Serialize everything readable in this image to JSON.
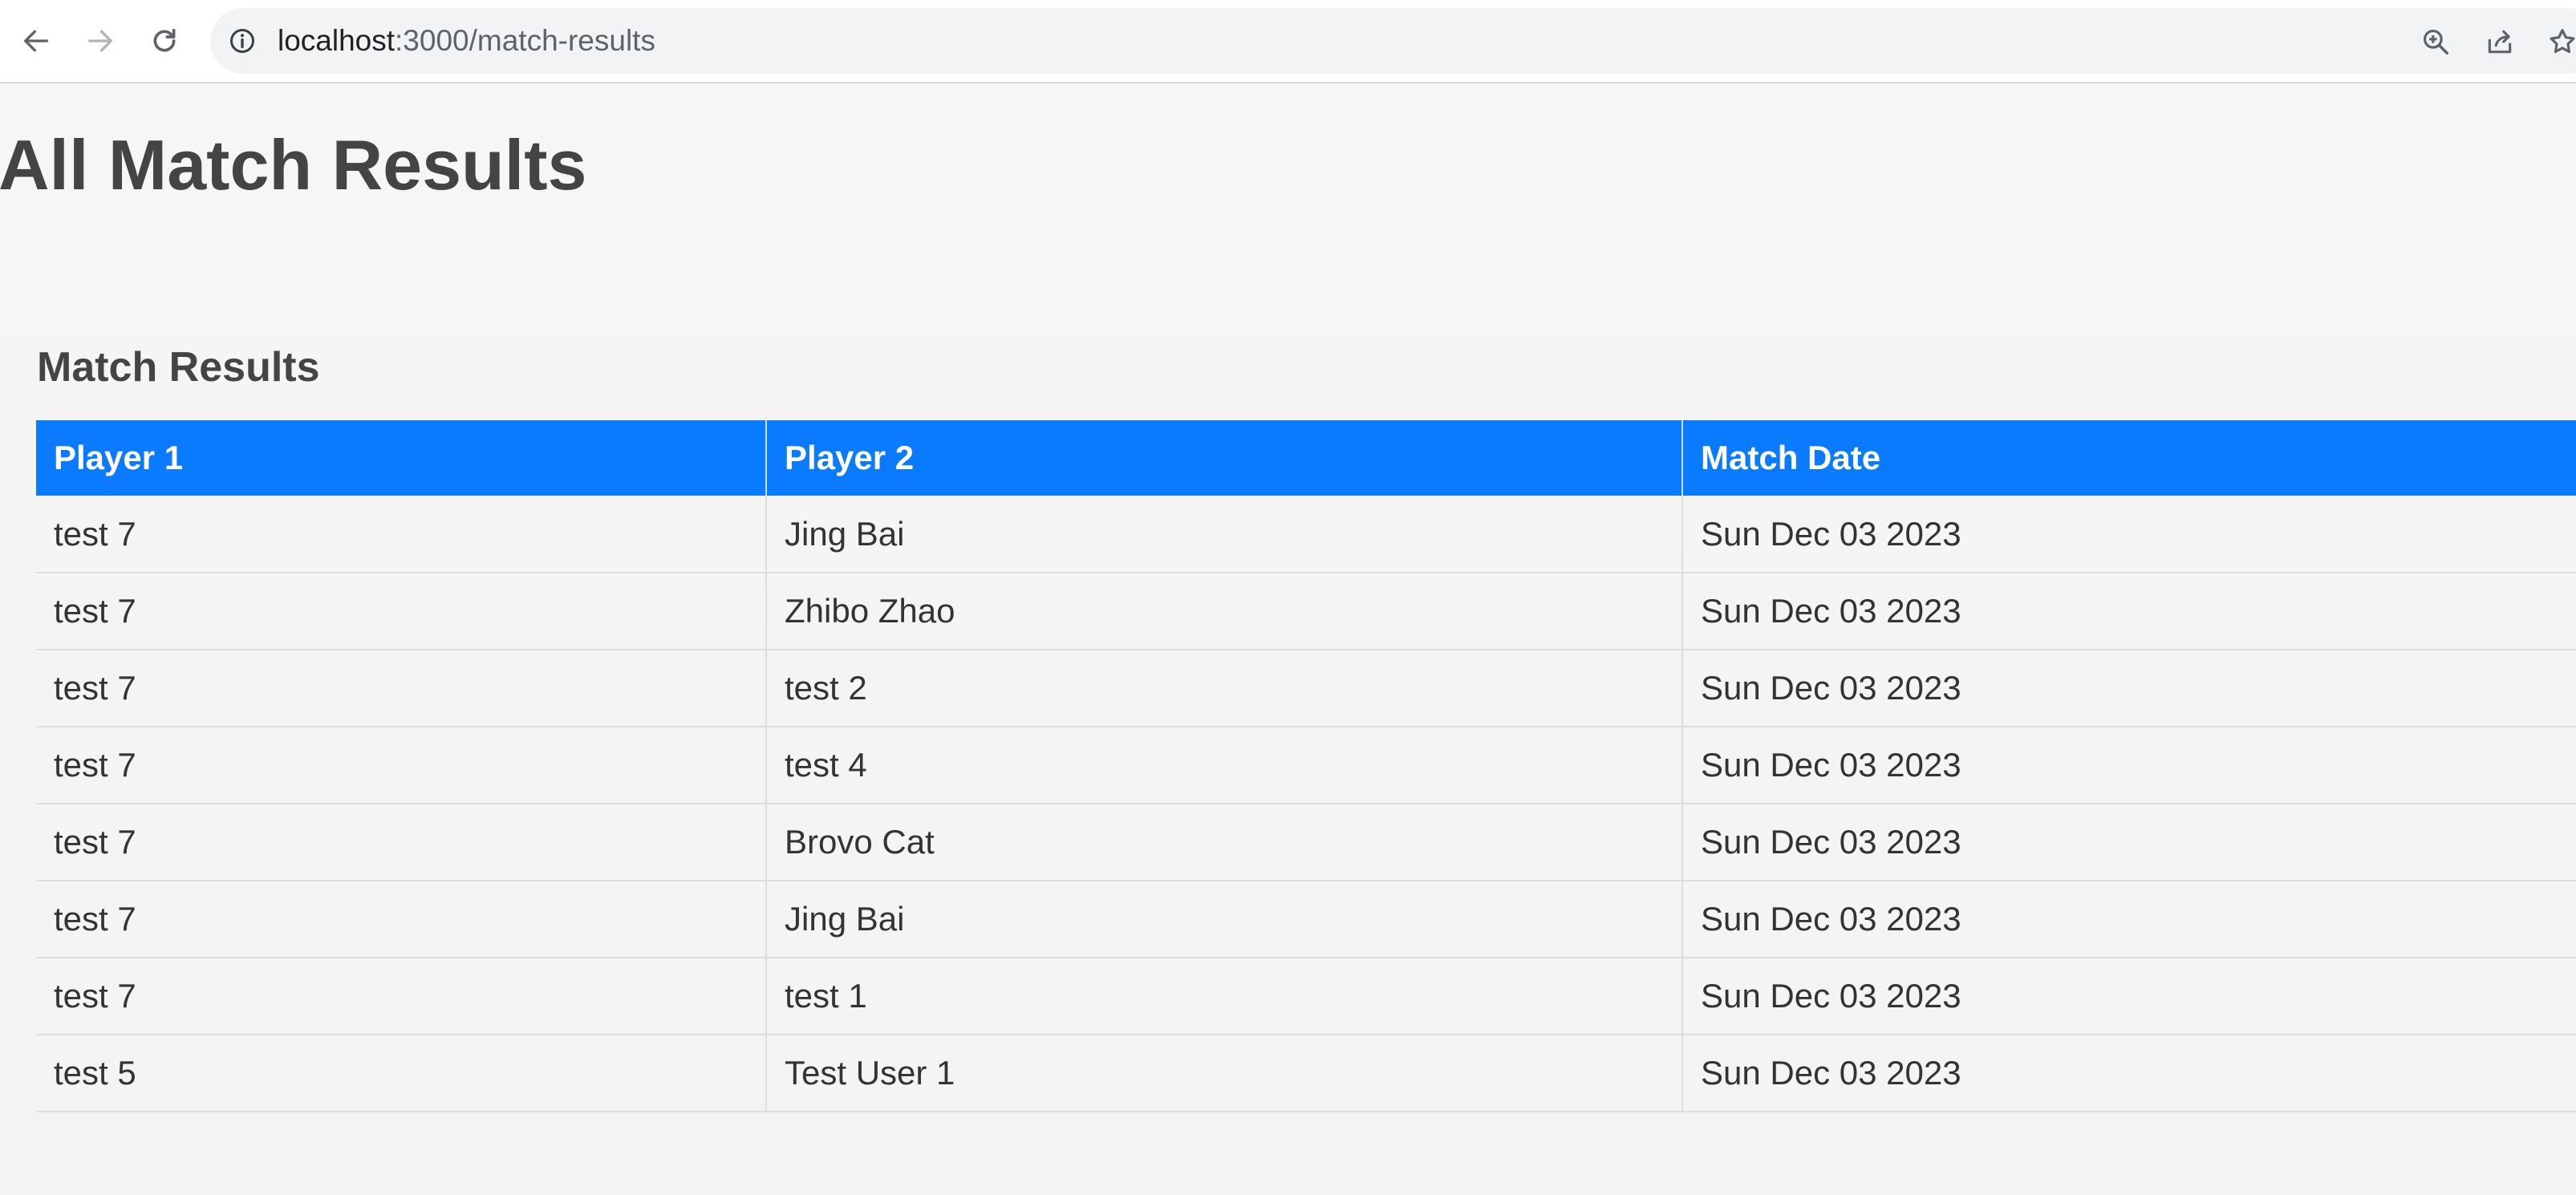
{
  "browser": {
    "url_host": "localhost",
    "url_path": ":3000/match-results",
    "icons": [
      "back-arrow-icon",
      "forward-arrow-icon",
      "reload-icon",
      "site-info-icon",
      "zoom-icon",
      "share-icon",
      "bookmark-star-icon"
    ]
  },
  "page": {
    "title": "All Match Results",
    "section_title": "Match Results"
  },
  "table": {
    "headers": [
      "Player 1",
      "Player 2",
      "Match Date"
    ],
    "rows": [
      [
        "test 7",
        "Jing Bai",
        "Sun Dec 03 2023"
      ],
      [
        "test 7",
        "Zhibo Zhao",
        "Sun Dec 03 2023"
      ],
      [
        "test 7",
        "test 2",
        "Sun Dec 03 2023"
      ],
      [
        "test 7",
        "test 4",
        "Sun Dec 03 2023"
      ],
      [
        "test 7",
        "Brovo Cat",
        "Sun Dec 03 2023"
      ],
      [
        "test 7",
        "Jing Bai",
        "Sun Dec 03 2023"
      ],
      [
        "test 7",
        "test 1",
        "Sun Dec 03 2023"
      ],
      [
        "test 5",
        "Test User 1",
        "Sun Dec 03 2023"
      ]
    ]
  },
  "colors": {
    "header_bg": "#0a7bff",
    "header_text": "#ffffff",
    "title_text": "#444444",
    "cell_text": "#333333"
  }
}
